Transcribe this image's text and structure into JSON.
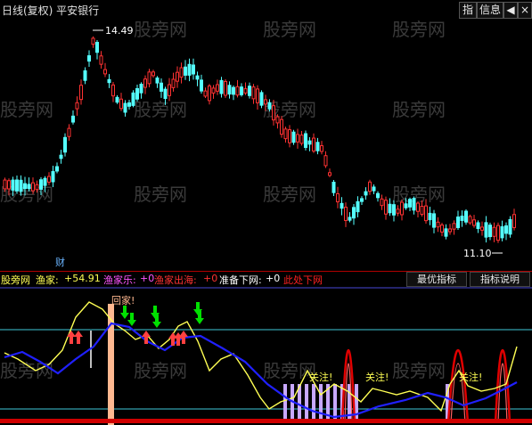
{
  "title": "日线(复权) 平安银行",
  "top_buttons": {
    "indicator": "指",
    "info": "信息",
    "back_arrow": "◀",
    "close": "×"
  },
  "price_chart": {
    "high_label": "14.49",
    "low_label": "11.10",
    "finance_marker": "财",
    "watermark": "股旁网"
  },
  "indicator_bar": {
    "site": "股旁网",
    "yujia_label": "渔家:",
    "yujia_value": "+54.91",
    "yujiale_label": "渔家乐:",
    "yujiale_value": "+0",
    "yujiachuhai_label": "渔家出海:",
    "yujiachuhai_value": "+0",
    "zhunbeixiawang_label": "准备下网:",
    "zhunbeixiawang_value": "+0",
    "trailing": "此处下网"
  },
  "indicator_buttons": {
    "best": "最优指标",
    "help": "指标说明"
  },
  "indicator_chart": {
    "hui_jia": "回家!",
    "guan_zhu": [
      "关注!",
      "关注!",
      "关注!"
    ]
  },
  "colors": {
    "background": "#000000",
    "up_candle": "#ff3232",
    "down_candle": "#54ffff",
    "yellow_line": "#ffff54",
    "blue_line": "#2020ff",
    "red_spike": "#e00000",
    "green_arrow": "#00e000"
  }
}
